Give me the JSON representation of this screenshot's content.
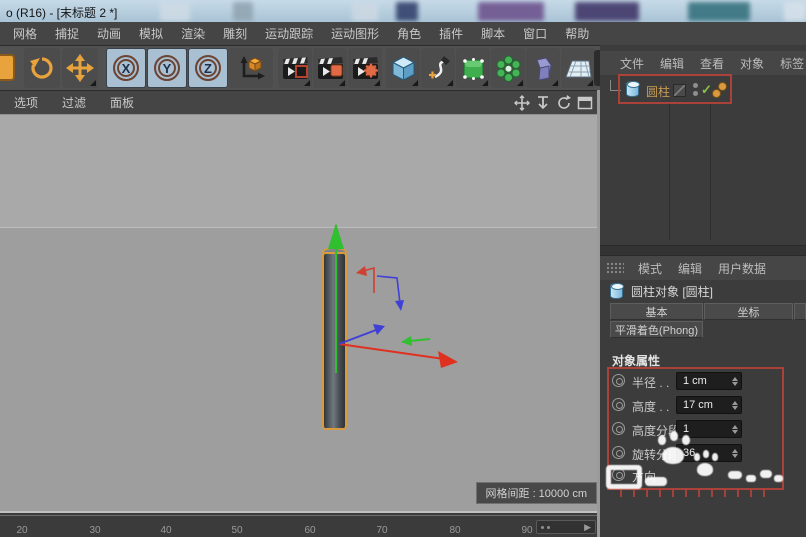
{
  "window": {
    "title": "o (R16) - [末标题 2 *]"
  },
  "menubar": {
    "items": [
      "网格",
      "捕捉",
      "动画",
      "模拟",
      "渲染",
      "雕刻",
      "运动跟踪",
      "运动图形",
      "角色",
      "插件",
      "脚本",
      "窗口",
      "帮助"
    ]
  },
  "toolbar": {
    "axis_lock": [
      "X",
      "Y",
      "Z"
    ],
    "icons": [
      "undo",
      "rotate-tool",
      "move-tool",
      "lock-x",
      "lock-y",
      "lock-z",
      "coordinate-system",
      "render-view",
      "render-to-picture-viewer",
      "edit-render-settings",
      "primitive-cube",
      "spline-pen",
      "subdivision-surface",
      "array-generator",
      "deformer",
      "floor-environment"
    ]
  },
  "viewport": {
    "menu": [
      "选项",
      "过滤",
      "面板"
    ],
    "grid_label": "网格间距 : 10000 cm"
  },
  "object_manager": {
    "menus": [
      "文件",
      "编辑",
      "查看",
      "对象",
      "标签"
    ],
    "objects": [
      {
        "name": "圆柱",
        "enabled_check": "✓"
      }
    ]
  },
  "attribute_manager": {
    "menus": [
      "模式",
      "编辑",
      "用户数据"
    ],
    "title": "圆柱对象 [圆柱]",
    "tabs": [
      "基本",
      "坐标"
    ],
    "tabs_row2": [
      "平滑着色(Phong)"
    ],
    "section": "对象属性",
    "properties": [
      {
        "label": "半径 . .",
        "value": "1 cm"
      },
      {
        "label": "高度 . .",
        "value": "17 cm"
      },
      {
        "label": "高度分段",
        "value": "1"
      },
      {
        "label": "旋转分段",
        "value": "36"
      },
      {
        "label": "方向",
        "value": ""
      }
    ]
  },
  "timeline": {
    "ticks": [
      "20",
      "30",
      "40",
      "50",
      "60",
      "70",
      "80",
      "90"
    ]
  },
  "colors": {
    "annotation_red": "#b5433a",
    "selection_orange": "#d89a3c",
    "axis_x_red": "#e03020",
    "axis_y_green": "#2fbf2f",
    "axis_z_blue": "#4040d8",
    "object_name_orange": "#c79c55"
  }
}
